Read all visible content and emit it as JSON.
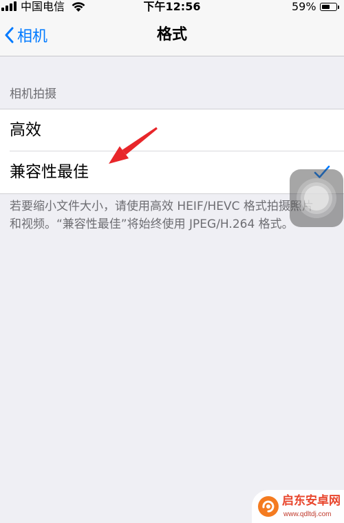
{
  "status_bar": {
    "carrier": "中国电信",
    "time": "下午12:56",
    "battery_text": "59%",
    "battery_level": 0.59,
    "signal_icon": "signal-icon",
    "wifi_icon": "wifi-icon",
    "battery_icon": "battery-icon"
  },
  "nav": {
    "back_label": "相机",
    "back_icon": "chevron-left-icon",
    "title": "格式"
  },
  "section": {
    "header": "相机拍摄",
    "rows": [
      {
        "label": "高效",
        "selected": false
      },
      {
        "label": "兼容性最佳",
        "selected": true
      }
    ],
    "check_icon": "checkmark-icon",
    "footer_lines": [
      "若要缩小文件大小，请使用高效 HEIF/HEVC 格式拍摄照片",
      "和视频。“兼容性最佳”将始终使用 JPEG/H.264 格式。"
    ]
  },
  "overlays": {
    "assistive_touch_icon": "assistive-touch-icon",
    "annotation_icon": "red-arrow-icon"
  },
  "watermark": {
    "name": "启东安卓网",
    "url": "www.qdltdj.com",
    "logo_icon": "watermark-logo-icon"
  },
  "colors": {
    "accent": "#007aff",
    "annotation": "#e8262a",
    "background": "#efeff4",
    "secondary_text": "#6d6d72"
  }
}
